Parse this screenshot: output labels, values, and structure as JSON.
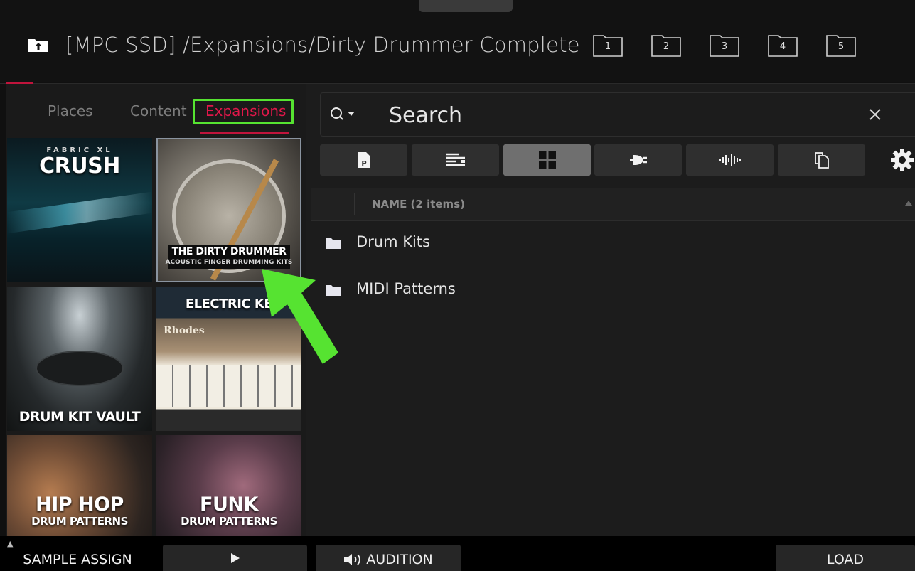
{
  "header": {
    "path": "[MPC SSD] /Expansions/Dirty Drummer Complete",
    "folders": [
      "1",
      "2",
      "3",
      "4",
      "5"
    ]
  },
  "tabs": [
    "Places",
    "Content",
    "Expansions"
  ],
  "active_tab": "Expansions",
  "expansions": [
    {
      "title": "CRUSH",
      "sub": "FABRIC XL"
    },
    {
      "title": "THE DIRTY DRUMMER",
      "sub": "ACOUSTIC FINGER DRUMMING KITS"
    },
    {
      "title": "DRUM KIT VAULT",
      "sub": ""
    },
    {
      "title": "ELECTRIC KE",
      "sub": "Rhodes"
    },
    {
      "title": "HIP HOP",
      "sub": "DRUM PATTERNS"
    },
    {
      "title": "FUNK",
      "sub": "DRUM PATTERNS"
    }
  ],
  "search": {
    "placeholder": "Search"
  },
  "filters": [
    "program-icon",
    "sequence-icon",
    "grid-icon",
    "plugin-icon",
    "waveform-icon",
    "copy-icon"
  ],
  "list": {
    "column": "NAME (2 items)",
    "items": [
      "Drum Kits",
      "MIDI Patterns"
    ]
  },
  "bottom_bar": {
    "sample_assign": "SAMPLE ASSIGN",
    "audition": "AUDITION",
    "load": "LOAD"
  },
  "colors": {
    "accent": "#e0174a",
    "highlight": "#56e331"
  }
}
